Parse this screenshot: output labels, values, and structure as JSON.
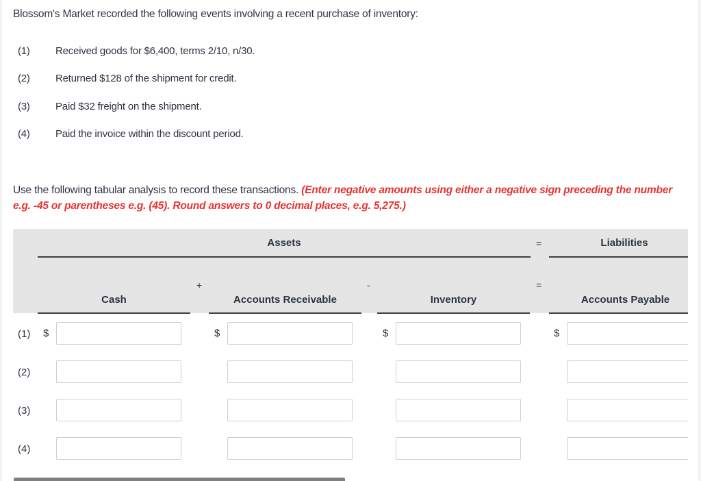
{
  "intro": "Blossom's Market recorded the following events involving a recent purchase of inventory:",
  "events": [
    {
      "num": "(1)",
      "text": "Received goods for $6,400, terms 2/10, n/30."
    },
    {
      "num": "(2)",
      "text": "Returned $128 of the shipment for credit."
    },
    {
      "num": "(3)",
      "text": "Paid $32 freight on the shipment."
    },
    {
      "num": "(4)",
      "text": "Paid the invoice within the discount period."
    }
  ],
  "instructions": {
    "text": "Use the following tabular analysis to record these transactions. ",
    "note": "(Enter negative amounts using either a negative sign preceding the number e.g. -45 or parentheses e.g. (45). Round answers to 0 decimal places, e.g. 5,275.)"
  },
  "table": {
    "group_headers": {
      "assets": "Assets",
      "equals": "=",
      "liabilities": "Liabilities"
    },
    "operators": {
      "plus": "+",
      "minus": "-",
      "equals": "="
    },
    "columns": [
      "Cash",
      "Accounts Receivable",
      "Inventory",
      "Accounts Payable"
    ],
    "currency_symbol": "$",
    "rows": [
      {
        "label": "(1)",
        "values": [
          "",
          "",
          "",
          ""
        ]
      },
      {
        "label": "(2)",
        "values": [
          "",
          "",
          "",
          ""
        ]
      },
      {
        "label": "(3)",
        "values": [
          "",
          "",
          "",
          ""
        ]
      },
      {
        "label": "(4)",
        "values": [
          "",
          "",
          "",
          ""
        ]
      }
    ]
  },
  "colors": {
    "accent_red": "#e8312f",
    "header_bg": "#e5e5e5",
    "scrollbar": "#808080"
  }
}
